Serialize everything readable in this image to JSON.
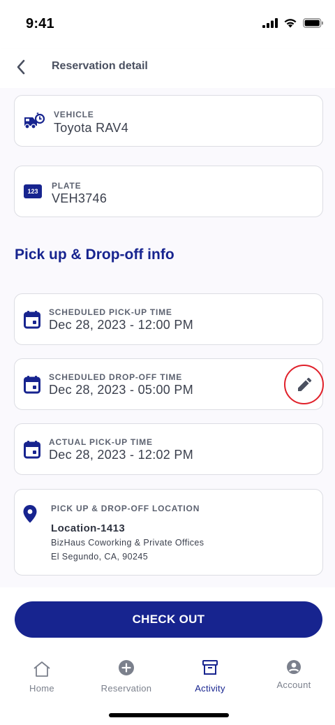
{
  "status_bar": {
    "time": "9:41"
  },
  "header": {
    "title": "Reservation detail"
  },
  "vehicle": {
    "label": "VEHICLE",
    "value": "Toyota RAV4"
  },
  "plate": {
    "label": "PLATE",
    "value": "VEH3746",
    "icon_text": "123"
  },
  "section": {
    "title": "Pick up & Drop-off info"
  },
  "scheduled_pickup": {
    "label": "SCHEDULED PICK-UP TIME",
    "value": "Dec 28, 2023 - 12:00 PM"
  },
  "scheduled_dropoff": {
    "label": "SCHEDULED DROP-OFF TIME",
    "value": "Dec 28, 2023 - 05:00 PM"
  },
  "actual_pickup": {
    "label": "ACTUAL PICK-UP TIME",
    "value": "Dec 28, 2023 - 12:02 PM"
  },
  "location": {
    "label": "PICK UP & DROP-OFF LOCATION",
    "name": "Location-1413",
    "address_line1": "BizHaus Coworking & Private Offices",
    "address_line2": "El Segundo, CA, 90245"
  },
  "checkout": {
    "label": "CHECK OUT"
  },
  "tabs": [
    {
      "label": "Home",
      "icon": "home-icon",
      "active": false
    },
    {
      "label": "Reservation",
      "icon": "plus-circle-icon",
      "active": false
    },
    {
      "label": "Activity",
      "icon": "archive-icon",
      "active": true
    },
    {
      "label": "Account",
      "icon": "account-icon",
      "active": false
    }
  ],
  "colors": {
    "primary": "#17248f",
    "highlight": "#e0202a",
    "text": "#3a3f4c"
  }
}
